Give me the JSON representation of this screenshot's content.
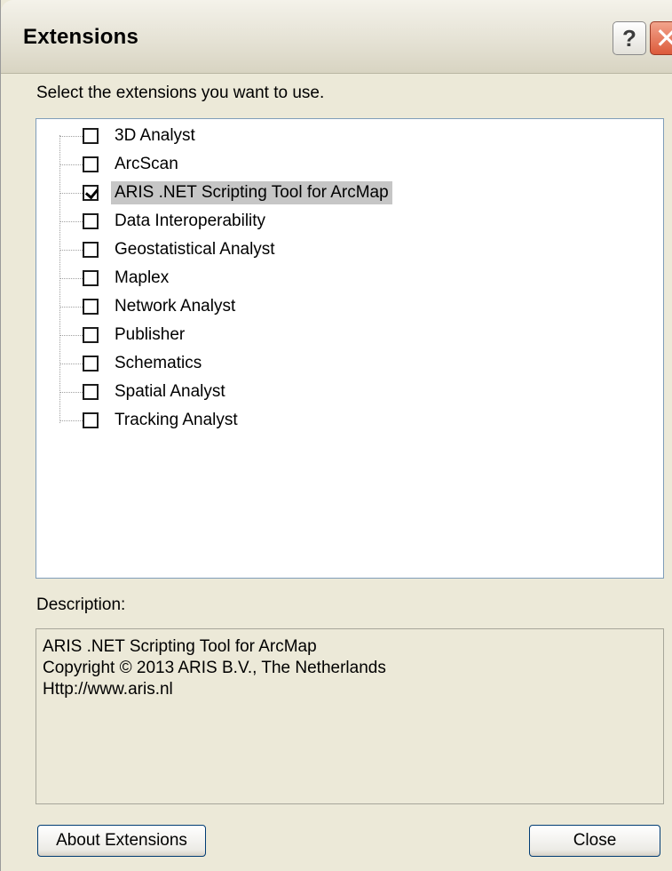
{
  "window": {
    "title": "Extensions",
    "help_glyph": "?",
    "close_glyph": "✕"
  },
  "prompt": "Select the extensions you want to use.",
  "extensions": [
    {
      "label": "3D Analyst",
      "checked": false,
      "selected": false
    },
    {
      "label": "ArcScan",
      "checked": false,
      "selected": false
    },
    {
      "label": "ARIS .NET Scripting Tool for ArcMap",
      "checked": true,
      "selected": true
    },
    {
      "label": "Data Interoperability",
      "checked": false,
      "selected": false
    },
    {
      "label": "Geostatistical Analyst",
      "checked": false,
      "selected": false
    },
    {
      "label": "Maplex",
      "checked": false,
      "selected": false
    },
    {
      "label": "Network Analyst",
      "checked": false,
      "selected": false
    },
    {
      "label": "Publisher",
      "checked": false,
      "selected": false
    },
    {
      "label": "Schematics",
      "checked": false,
      "selected": false
    },
    {
      "label": "Spatial Analyst",
      "checked": false,
      "selected": false
    },
    {
      "label": "Tracking Analyst",
      "checked": false,
      "selected": false
    }
  ],
  "description": {
    "label": "Description:",
    "lines": [
      "ARIS .NET Scripting Tool for ArcMap",
      "Copyright © 2013 ARIS B.V., The Netherlands",
      "Http://www.aris.nl"
    ]
  },
  "buttons": {
    "about": "About Extensions",
    "close": "Close"
  },
  "colors": {
    "dialog_bg": "#ece9d8",
    "selection_bg": "#c6c6c6",
    "listbox_border": "#7f9db9",
    "close_button": "#dc5a3a"
  },
  "icons": {
    "help": "help-icon",
    "close": "close-icon",
    "checkbox_checked": "check-icon"
  }
}
